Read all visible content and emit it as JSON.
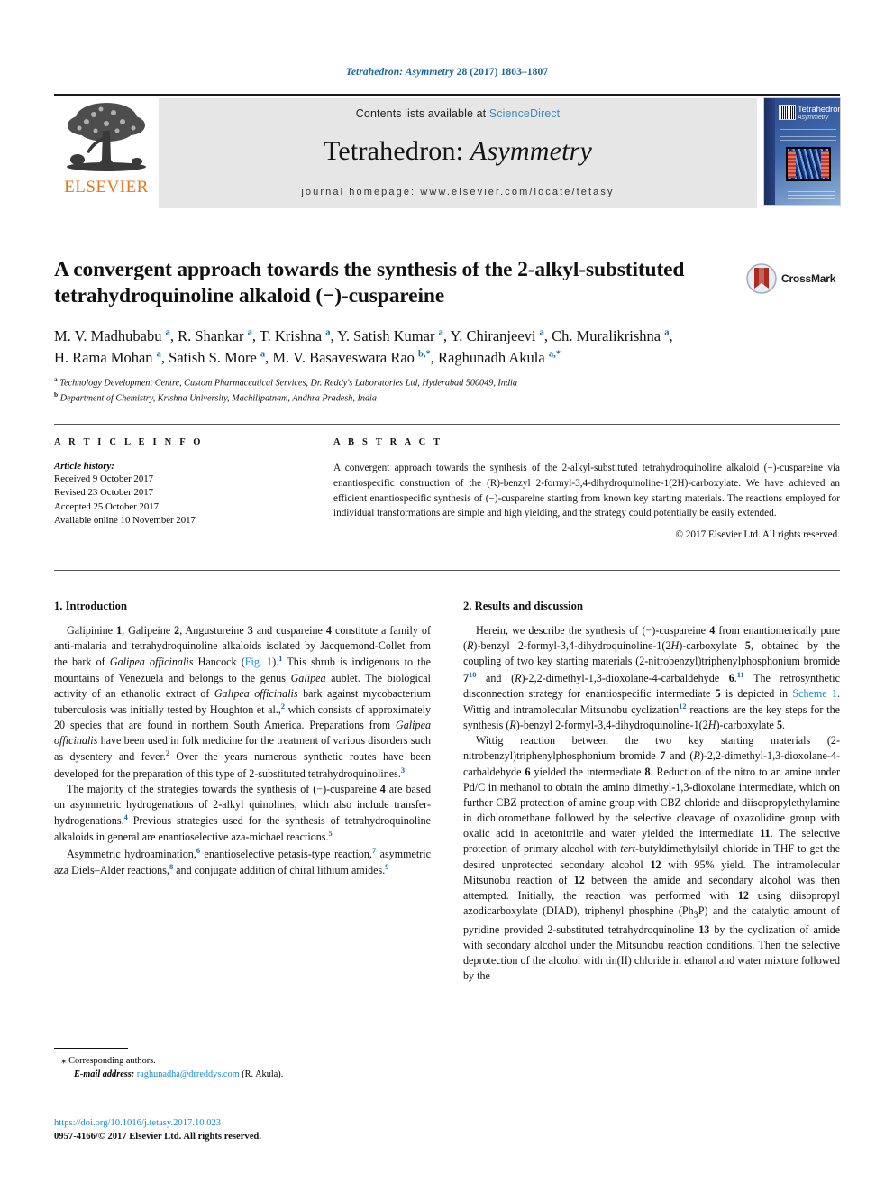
{
  "running_head": {
    "journal_italic": "Tetrahedron: Asymmetry",
    "citation": " 28 (2017) 1803–1807"
  },
  "masthead": {
    "publisher_name": "ELSEVIER",
    "contents_prefix": "Contents lists available at ",
    "contents_link": "ScienceDirect",
    "journal_title_plain": "Tetrahedron: ",
    "journal_title_italic": "Asymmetry",
    "homepage": "journal homepage: www.elsevier.com/locate/tetasy",
    "cover": {
      "title": "Tetrahedron:",
      "subtitle": "Asymmetry"
    }
  },
  "article": {
    "title": "A convergent approach towards the synthesis of the 2-alkyl-substituted tetrahydroquinoline alkaloid (−)-cuspareine",
    "crossmark_label": "CrossMark",
    "authors_line1": "M. V. Madhubabu a, R. Shankar a, T. Krishna a, Y. Satish Kumar a, Y. Chiranjeevi a, Ch. Muralikrishna a,",
    "authors_line2": "H. Rama Mohan a, Satish S. More a, M. V. Basaveswara Rao b,*, Raghunadh Akula a,*",
    "affiliation_a": "Technology Development Centre, Custom Pharmaceutical Services, Dr. Reddy's Laboratories Ltd, Hyderabad 500049, India",
    "affiliation_b": "Department of Chemistry, Krishna University, Machilipatnam, Andhra Pradesh, India"
  },
  "info": {
    "heading": "A R T I C L E   I N F O",
    "history_label": "Article history:",
    "history": [
      "Received 9 October 2017",
      "Revised 23 October 2017",
      "Accepted 25 October 2017",
      "Available online 10 November 2017"
    ]
  },
  "abstract": {
    "heading": "A B S T R A C T",
    "text": "A convergent approach towards the synthesis of the 2-alkyl-substituted tetrahydroquinoline alkaloid (−)-cuspareine via enantiospecific construction of the (R)-benzyl 2-formyl-3,4-dihydroquinoline-1(2H)-carboxylate. We have achieved an efficient enantiospecific synthesis of (−)-cuspareine starting from known key starting materials. The reactions employed for individual transformations are simple and high yielding, and the strategy could potentially be easily extended.",
    "copyright": "© 2017 Elsevier Ltd. All rights reserved."
  },
  "sections": {
    "introduction": {
      "heading": "1. Introduction",
      "paragraphs": [
        "Galipinine 1, Galipeine 2, Angustureine 3 and cuspareine 4 constitute a family of anti-malaria and tetrahydroquinoline alkaloids isolated by Jacquemond-Collet from the bark of Galipea officinalis Hancock (Fig. 1).1 This shrub is indigenous to the mountains of Venezuela and belongs to the genus Galipea aublet. The biological activity of an ethanolic extract of Galipea officinalis bark against mycobacterium tuberculosis was initially tested by Houghton et al.,2 which consists of approximately 20 species that are found in northern South America. Preparations from Galipea officinalis have been used in folk medicine for the treatment of various disorders such as dysentery and fever.2 Over the years numerous synthetic routes have been developed for the preparation of this type of 2-substituted tetrahydroquinolines.3",
        "The majority of the strategies towards the synthesis of (−)-cuspareine 4 are based on asymmetric hydrogenations of 2-alkyl quinolines, which also include transfer-hydrogenations.4 Previous strategies used for the synthesis of tetrahydroquinoline alkaloids in general are enantioselective aza-michael reactions.5",
        "Asymmetric hydroamination,6 enantioselective petasis-type reaction,7 asymmetric aza Diels–Alder reactions,8 and conjugate addition of chiral lithium amides.9"
      ]
    },
    "results": {
      "heading": "2. Results and discussion",
      "paragraphs": [
        "Herein, we describe the synthesis of (−)-cuspareine 4 from enantiomerically pure (R)-benzyl 2-formyl-3,4-dihydroquinoline-1(2H)-carboxylate 5, obtained by the coupling of two key starting materials (2-nitrobenzyl)triphenylphosphonium bromide 710 and (R)-2,2-dimethyl-1,3-dioxolane-4-carbaldehyde 6.11 The retrosynthetic disconnection strategy for enantiospecific intermediate 5 is depicted in Scheme 1. Wittig and intramolecular Mitsunobu cyclization12 reactions are the key steps for the synthesis (R)-benzyl 2-formyl-3,4-dihydroquinoline-1(2H)-carboxylate 5.",
        "Wittig reaction between the two key starting materials (2-nitrobenzyl)triphenylphosphonium bromide 7 and (R)-2,2-dimethyl-1,3-dioxolane-4-carbaldehyde 6 yielded the intermediate 8. Reduction of the nitro to an amine under Pd/C in methanol to obtain the amino dimethyl-1,3-dioxolane intermediate, which on further CBZ protection of amine group with CBZ chloride and diisopropylethylamine in dichloromethane followed by the selective cleavage of oxazolidine group with oxalic acid in acetonitrile and water yielded the intermediate 11. The selective protection of primary alcohol with tert-butyldimethylsilyl chloride in THF to get the desired unprotected secondary alcohol 12 with 95% yield. The intramolecular Mitsunobu reaction of 12 between the amide and secondary alcohol was then attempted. Initially, the reaction was performed with 12 using diisopropyl azodicarboxylate (DIAD), triphenyl phosphine (Ph3P) and the catalytic amount of pyridine provided 2-substituted tetrahydroquinoline 13 by the cyclization of amide with secondary alcohol under the Mitsunobu reaction conditions. Then the selective deprotection of the alcohol with tin(II) chloride in ethanol and water mixture followed by the"
      ]
    }
  },
  "footnotes": {
    "corresponding": "Corresponding authors.",
    "email_label": "E-mail address:",
    "email": "raghunadha@drreddys.com",
    "email_suffix": " (R. Akula).",
    "doi": "https://doi.org/10.1016/j.tetasy.2017.10.023",
    "issn_line": "0957-4166/© 2017 Elsevier Ltd. All rights reserved."
  },
  "colors": {
    "link": "#1a8cc8",
    "header_blue": "#1a6496",
    "elsevier_orange": "#E87722",
    "band_gray": "#e6e6e6"
  }
}
